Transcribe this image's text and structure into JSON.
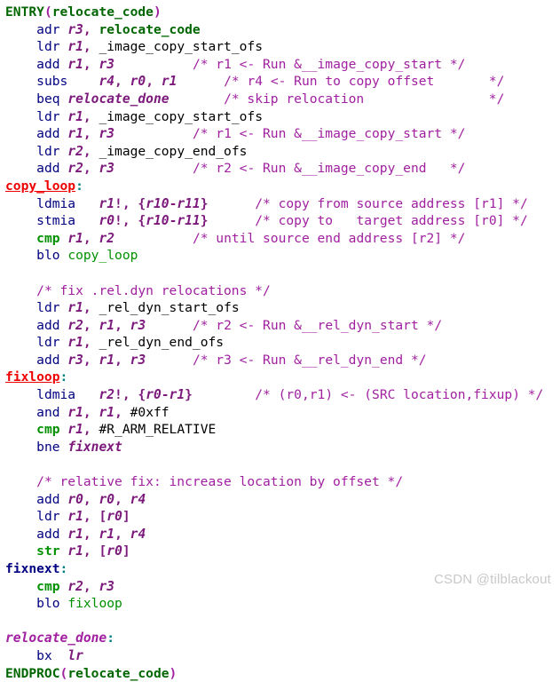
{
  "editor": {
    "language": "arm-assembly",
    "background": "#ffffff",
    "colors": {
      "macro_green": "#006600",
      "keyword_green": "#009000",
      "opcode_navy": "#000080",
      "register_purple": "#7c1a7c",
      "comment_magenta": "#a020a0",
      "label_red": "#ee0000",
      "label_navy": "#000080",
      "label_purple": "#a020a0",
      "colon_teal": "#008080",
      "watermark_gray": "#c8c8c8",
      "text_black": "#000000"
    }
  },
  "lines": [
    {
      "id": "l01",
      "text": "ENTRY(relocate_code)"
    },
    {
      "id": "l02",
      "text": "    adr r3, relocate_code"
    },
    {
      "id": "l03",
      "text": "    ldr r1, _image_copy_start_ofs"
    },
    {
      "id": "l04",
      "text": "    add r1, r3          /* r1 <- Run &__image_copy_start */"
    },
    {
      "id": "l05",
      "text": "    subs    r4, r0, r1      /* r4 <- Run to copy offset       */"
    },
    {
      "id": "l06",
      "text": "    beq relocate_done       /* skip relocation                */"
    },
    {
      "id": "l07",
      "text": "    ldr r1, _image_copy_start_ofs"
    },
    {
      "id": "l08",
      "text": "    add r1, r3          /* r1 <- Run &__image_copy_start */"
    },
    {
      "id": "l09",
      "text": "    ldr r2, _image_copy_end_ofs"
    },
    {
      "id": "l10",
      "text": "    add r2, r3          /* r2 <- Run &__image_copy_end   */"
    },
    {
      "id": "l11",
      "text": "copy_loop:"
    },
    {
      "id": "l12",
      "text": "    ldmia   r1!, {r10-r11}      /* copy from source address [r1] */"
    },
    {
      "id": "l13",
      "text": "    stmia   r0!, {r10-r11}      /* copy to   target address [r0] */"
    },
    {
      "id": "l14",
      "text": "    cmp r1, r2          /* until source end address [r2] */"
    },
    {
      "id": "l15",
      "text": "    blo copy_loop"
    },
    {
      "id": "l16",
      "text": ""
    },
    {
      "id": "l17",
      "text": "    /* fix .rel.dyn relocations */"
    },
    {
      "id": "l18",
      "text": "    ldr r1, _rel_dyn_start_ofs"
    },
    {
      "id": "l19",
      "text": "    add r2, r1, r3      /* r2 <- Run &__rel_dyn_start */"
    },
    {
      "id": "l20",
      "text": "    ldr r1, _rel_dyn_end_ofs"
    },
    {
      "id": "l21",
      "text": "    add r3, r1, r3      /* r3 <- Run &__rel_dyn_end */"
    },
    {
      "id": "l22",
      "text": "fixloop:"
    },
    {
      "id": "l23",
      "text": "    ldmia   r2!, {r0-r1}        /* (r0,r1) <- (SRC location,fixup) */"
    },
    {
      "id": "l24",
      "text": "    and r1, r1, #0xff"
    },
    {
      "id": "l25",
      "text": "    cmp r1, #R_ARM_RELATIVE"
    },
    {
      "id": "l26",
      "text": "    bne fixnext"
    },
    {
      "id": "l27",
      "text": ""
    },
    {
      "id": "l28",
      "text": "    /* relative fix: increase location by offset */"
    },
    {
      "id": "l29",
      "text": "    add r0, r0, r4"
    },
    {
      "id": "l30",
      "text": "    ldr r1, [r0]"
    },
    {
      "id": "l31",
      "text": "    add r1, r1, r4"
    },
    {
      "id": "l32",
      "text": "    str r1, [r0]"
    },
    {
      "id": "l33",
      "text": "fixnext:"
    },
    {
      "id": "l34",
      "text": "    cmp r2, r3"
    },
    {
      "id": "l35",
      "text": "    blo fixloop"
    },
    {
      "id": "l36",
      "text": ""
    },
    {
      "id": "l37",
      "text": "relocate_done:"
    },
    {
      "id": "l38",
      "text": "    bx  lr"
    },
    {
      "id": "l39",
      "text": "ENDPROC(relocate_code)"
    }
  ],
  "tokens": {
    "l01": [
      {
        "t": "ENTRY",
        "c": "t-macro"
      },
      {
        "t": "(",
        "c": "t-paren"
      },
      {
        "t": "relocate_code",
        "c": "t-sym"
      },
      {
        "t": ")",
        "c": "t-paren"
      }
    ],
    "l02": [
      {
        "t": "    ",
        "c": "t-ident"
      },
      {
        "t": "adr",
        "c": "t-op"
      },
      {
        "t": " ",
        "c": "t-ident"
      },
      {
        "t": "r3",
        "c": "t-reg"
      },
      {
        "t": ",",
        "c": "t-punct"
      },
      {
        "t": " ",
        "c": "t-ident"
      },
      {
        "t": "relocate_code",
        "c": "t-sym"
      }
    ],
    "l03": [
      {
        "t": "    ",
        "c": "t-ident"
      },
      {
        "t": "ldr",
        "c": "t-op"
      },
      {
        "t": " ",
        "c": "t-ident"
      },
      {
        "t": "r1",
        "c": "t-reg"
      },
      {
        "t": ",",
        "c": "t-punct"
      },
      {
        "t": " _image_copy_start_ofs",
        "c": "t-ident"
      }
    ],
    "l04": [
      {
        "t": "    ",
        "c": "t-ident"
      },
      {
        "t": "add",
        "c": "t-op"
      },
      {
        "t": " ",
        "c": "t-ident"
      },
      {
        "t": "r1",
        "c": "t-reg"
      },
      {
        "t": ",",
        "c": "t-punct"
      },
      {
        "t": " ",
        "c": "t-ident"
      },
      {
        "t": "r3",
        "c": "t-reg"
      },
      {
        "t": "          ",
        "c": "t-ident"
      },
      {
        "t": "/* r1 <- Run &__image_copy_start */",
        "c": "t-comment"
      }
    ],
    "l05": [
      {
        "t": "    ",
        "c": "t-ident"
      },
      {
        "t": "subs",
        "c": "t-op"
      },
      {
        "t": "    ",
        "c": "t-ident"
      },
      {
        "t": "r4",
        "c": "t-reg"
      },
      {
        "t": ",",
        "c": "t-punct"
      },
      {
        "t": " ",
        "c": "t-ident"
      },
      {
        "t": "r0",
        "c": "t-reg"
      },
      {
        "t": ",",
        "c": "t-punct"
      },
      {
        "t": " ",
        "c": "t-ident"
      },
      {
        "t": "r1",
        "c": "t-reg"
      },
      {
        "t": "      ",
        "c": "t-ident"
      },
      {
        "t": "/* r4 <- Run to copy offset       */",
        "c": "t-comment"
      }
    ],
    "l06": [
      {
        "t": "    ",
        "c": "t-ident"
      },
      {
        "t": "beq",
        "c": "t-op"
      },
      {
        "t": " ",
        "c": "t-ident"
      },
      {
        "t": "relocate_done",
        "c": "t-target-purple"
      },
      {
        "t": "       ",
        "c": "t-ident"
      },
      {
        "t": "/* skip relocation                */",
        "c": "t-comment"
      }
    ],
    "l07": [
      {
        "t": "    ",
        "c": "t-ident"
      },
      {
        "t": "ldr",
        "c": "t-op"
      },
      {
        "t": " ",
        "c": "t-ident"
      },
      {
        "t": "r1",
        "c": "t-reg"
      },
      {
        "t": ",",
        "c": "t-punct"
      },
      {
        "t": " _image_copy_start_ofs",
        "c": "t-ident"
      }
    ],
    "l08": [
      {
        "t": "    ",
        "c": "t-ident"
      },
      {
        "t": "add",
        "c": "t-op"
      },
      {
        "t": " ",
        "c": "t-ident"
      },
      {
        "t": "r1",
        "c": "t-reg"
      },
      {
        "t": ",",
        "c": "t-punct"
      },
      {
        "t": " ",
        "c": "t-ident"
      },
      {
        "t": "r3",
        "c": "t-reg"
      },
      {
        "t": "          ",
        "c": "t-ident"
      },
      {
        "t": "/* r1 <- Run &__image_copy_start */",
        "c": "t-comment"
      }
    ],
    "l09": [
      {
        "t": "    ",
        "c": "t-ident"
      },
      {
        "t": "ldr",
        "c": "t-op"
      },
      {
        "t": " ",
        "c": "t-ident"
      },
      {
        "t": "r2",
        "c": "t-reg"
      },
      {
        "t": ",",
        "c": "t-punct"
      },
      {
        "t": " _image_copy_end_ofs",
        "c": "t-ident"
      }
    ],
    "l10": [
      {
        "t": "    ",
        "c": "t-ident"
      },
      {
        "t": "add",
        "c": "t-op"
      },
      {
        "t": " ",
        "c": "t-ident"
      },
      {
        "t": "r2",
        "c": "t-reg"
      },
      {
        "t": ",",
        "c": "t-punct"
      },
      {
        "t": " ",
        "c": "t-ident"
      },
      {
        "t": "r3",
        "c": "t-reg"
      },
      {
        "t": "          ",
        "c": "t-ident"
      },
      {
        "t": "/* r2 <- Run &__image_copy_end   */",
        "c": "t-comment"
      }
    ],
    "l11": [
      {
        "t": "copy_loop",
        "c": "t-lbl-red"
      },
      {
        "t": ":",
        "c": "t-colon"
      }
    ],
    "l12": [
      {
        "t": "    ",
        "c": "t-ident"
      },
      {
        "t": "ldmia",
        "c": "t-op"
      },
      {
        "t": "   ",
        "c": "t-ident"
      },
      {
        "t": "r1",
        "c": "t-reg"
      },
      {
        "t": "!,",
        "c": "t-punct"
      },
      {
        "t": " ",
        "c": "t-ident"
      },
      {
        "t": "{",
        "c": "t-punct"
      },
      {
        "t": "r10",
        "c": "t-reg"
      },
      {
        "t": "-",
        "c": "t-punct"
      },
      {
        "t": "r11",
        "c": "t-reg"
      },
      {
        "t": "}",
        "c": "t-punct"
      },
      {
        "t": "      ",
        "c": "t-ident"
      },
      {
        "t": "/* copy from source address [r1] */",
        "c": "t-comment"
      }
    ],
    "l13": [
      {
        "t": "    ",
        "c": "t-ident"
      },
      {
        "t": "stmia",
        "c": "t-op"
      },
      {
        "t": "   ",
        "c": "t-ident"
      },
      {
        "t": "r0",
        "c": "t-reg"
      },
      {
        "t": "!,",
        "c": "t-punct"
      },
      {
        "t": " ",
        "c": "t-ident"
      },
      {
        "t": "{",
        "c": "t-punct"
      },
      {
        "t": "r10",
        "c": "t-reg"
      },
      {
        "t": "-",
        "c": "t-punct"
      },
      {
        "t": "r11",
        "c": "t-reg"
      },
      {
        "t": "}",
        "c": "t-punct"
      },
      {
        "t": "      ",
        "c": "t-ident"
      },
      {
        "t": "/* copy to   target address [r0] */",
        "c": "t-comment"
      }
    ],
    "l14": [
      {
        "t": "    ",
        "c": "t-ident"
      },
      {
        "t": "cmp",
        "c": "t-opg"
      },
      {
        "t": " ",
        "c": "t-ident"
      },
      {
        "t": "r1",
        "c": "t-reg"
      },
      {
        "t": ",",
        "c": "t-punct"
      },
      {
        "t": " ",
        "c": "t-ident"
      },
      {
        "t": "r2",
        "c": "t-reg"
      },
      {
        "t": "          ",
        "c": "t-ident"
      },
      {
        "t": "/* until source end address [r2] */",
        "c": "t-comment"
      }
    ],
    "l15": [
      {
        "t": "    ",
        "c": "t-ident"
      },
      {
        "t": "blo",
        "c": "t-op"
      },
      {
        "t": " ",
        "c": "t-ident"
      },
      {
        "t": "copy_loop",
        "c": "t-label-l"
      }
    ],
    "l16": [],
    "l17": [
      {
        "t": "    ",
        "c": "t-ident"
      },
      {
        "t": "/* fix .rel.dyn relocations */",
        "c": "t-comment"
      }
    ],
    "l18": [
      {
        "t": "    ",
        "c": "t-ident"
      },
      {
        "t": "ldr",
        "c": "t-op"
      },
      {
        "t": " ",
        "c": "t-ident"
      },
      {
        "t": "r1",
        "c": "t-reg"
      },
      {
        "t": ",",
        "c": "t-punct"
      },
      {
        "t": " _rel_dyn_start_ofs",
        "c": "t-ident"
      }
    ],
    "l19": [
      {
        "t": "    ",
        "c": "t-ident"
      },
      {
        "t": "add",
        "c": "t-op"
      },
      {
        "t": " ",
        "c": "t-ident"
      },
      {
        "t": "r2",
        "c": "t-reg"
      },
      {
        "t": ",",
        "c": "t-punct"
      },
      {
        "t": " ",
        "c": "t-ident"
      },
      {
        "t": "r1",
        "c": "t-reg"
      },
      {
        "t": ",",
        "c": "t-punct"
      },
      {
        "t": " ",
        "c": "t-ident"
      },
      {
        "t": "r3",
        "c": "t-reg"
      },
      {
        "t": "      ",
        "c": "t-ident"
      },
      {
        "t": "/* r2 <- Run &__rel_dyn_start */",
        "c": "t-comment"
      }
    ],
    "l20": [
      {
        "t": "    ",
        "c": "t-ident"
      },
      {
        "t": "ldr",
        "c": "t-op"
      },
      {
        "t": " ",
        "c": "t-ident"
      },
      {
        "t": "r1",
        "c": "t-reg"
      },
      {
        "t": ",",
        "c": "t-punct"
      },
      {
        "t": " _rel_dyn_end_ofs",
        "c": "t-ident"
      }
    ],
    "l21": [
      {
        "t": "    ",
        "c": "t-ident"
      },
      {
        "t": "add",
        "c": "t-op"
      },
      {
        "t": " ",
        "c": "t-ident"
      },
      {
        "t": "r3",
        "c": "t-reg"
      },
      {
        "t": ",",
        "c": "t-punct"
      },
      {
        "t": " ",
        "c": "t-ident"
      },
      {
        "t": "r1",
        "c": "t-reg"
      },
      {
        "t": ",",
        "c": "t-punct"
      },
      {
        "t": " ",
        "c": "t-ident"
      },
      {
        "t": "r3",
        "c": "t-reg"
      },
      {
        "t": "      ",
        "c": "t-ident"
      },
      {
        "t": "/* r3 <- Run &__rel_dyn_end */",
        "c": "t-comment"
      }
    ],
    "l22": [
      {
        "t": "fixloop",
        "c": "t-lbl-red"
      },
      {
        "t": ":",
        "c": "t-colon"
      }
    ],
    "l23": [
      {
        "t": "    ",
        "c": "t-ident"
      },
      {
        "t": "ldmia",
        "c": "t-op"
      },
      {
        "t": "   ",
        "c": "t-ident"
      },
      {
        "t": "r2",
        "c": "t-reg"
      },
      {
        "t": "!,",
        "c": "t-punct"
      },
      {
        "t": " ",
        "c": "t-ident"
      },
      {
        "t": "{",
        "c": "t-punct"
      },
      {
        "t": "r0",
        "c": "t-reg"
      },
      {
        "t": "-",
        "c": "t-punct"
      },
      {
        "t": "r1",
        "c": "t-reg"
      },
      {
        "t": "}",
        "c": "t-punct"
      },
      {
        "t": "        ",
        "c": "t-ident"
      },
      {
        "t": "/* (r0,r1) <- (SRC location,fixup) */",
        "c": "t-comment"
      }
    ],
    "l24": [
      {
        "t": "    ",
        "c": "t-ident"
      },
      {
        "t": "and",
        "c": "t-op"
      },
      {
        "t": " ",
        "c": "t-ident"
      },
      {
        "t": "r1",
        "c": "t-reg"
      },
      {
        "t": ",",
        "c": "t-punct"
      },
      {
        "t": " ",
        "c": "t-ident"
      },
      {
        "t": "r1",
        "c": "t-reg"
      },
      {
        "t": ",",
        "c": "t-punct"
      },
      {
        "t": " #0xff",
        "c": "t-ident"
      }
    ],
    "l25": [
      {
        "t": "    ",
        "c": "t-ident"
      },
      {
        "t": "cmp",
        "c": "t-opg"
      },
      {
        "t": " ",
        "c": "t-ident"
      },
      {
        "t": "r1",
        "c": "t-reg"
      },
      {
        "t": ",",
        "c": "t-punct"
      },
      {
        "t": " #R_ARM_RELATIVE",
        "c": "t-ident"
      }
    ],
    "l26": [
      {
        "t": "    ",
        "c": "t-ident"
      },
      {
        "t": "bne",
        "c": "t-op"
      },
      {
        "t": " ",
        "c": "t-ident"
      },
      {
        "t": "fixnext",
        "c": "t-target-purple"
      }
    ],
    "l27": [],
    "l28": [
      {
        "t": "    ",
        "c": "t-ident"
      },
      {
        "t": "/* relative fix: increase location by offset */",
        "c": "t-comment"
      }
    ],
    "l29": [
      {
        "t": "    ",
        "c": "t-ident"
      },
      {
        "t": "add",
        "c": "t-op"
      },
      {
        "t": " ",
        "c": "t-ident"
      },
      {
        "t": "r0",
        "c": "t-reg"
      },
      {
        "t": ",",
        "c": "t-punct"
      },
      {
        "t": " ",
        "c": "t-ident"
      },
      {
        "t": "r0",
        "c": "t-reg"
      },
      {
        "t": ",",
        "c": "t-punct"
      },
      {
        "t": " ",
        "c": "t-ident"
      },
      {
        "t": "r4",
        "c": "t-reg"
      }
    ],
    "l30": [
      {
        "t": "    ",
        "c": "t-ident"
      },
      {
        "t": "ldr",
        "c": "t-op"
      },
      {
        "t": " ",
        "c": "t-ident"
      },
      {
        "t": "r1",
        "c": "t-reg"
      },
      {
        "t": ",",
        "c": "t-punct"
      },
      {
        "t": " ",
        "c": "t-ident"
      },
      {
        "t": "[",
        "c": "t-punct"
      },
      {
        "t": "r0",
        "c": "t-reg"
      },
      {
        "t": "]",
        "c": "t-punct"
      }
    ],
    "l31": [
      {
        "t": "    ",
        "c": "t-ident"
      },
      {
        "t": "add",
        "c": "t-op"
      },
      {
        "t": " ",
        "c": "t-ident"
      },
      {
        "t": "r1",
        "c": "t-reg"
      },
      {
        "t": ",",
        "c": "t-punct"
      },
      {
        "t": " ",
        "c": "t-ident"
      },
      {
        "t": "r1",
        "c": "t-reg"
      },
      {
        "t": ",",
        "c": "t-punct"
      },
      {
        "t": " ",
        "c": "t-ident"
      },
      {
        "t": "r4",
        "c": "t-reg"
      }
    ],
    "l32": [
      {
        "t": "    ",
        "c": "t-ident"
      },
      {
        "t": "str",
        "c": "t-opg"
      },
      {
        "t": " ",
        "c": "t-ident"
      },
      {
        "t": "r1",
        "c": "t-reg"
      },
      {
        "t": ",",
        "c": "t-punct"
      },
      {
        "t": " ",
        "c": "t-ident"
      },
      {
        "t": "[",
        "c": "t-punct"
      },
      {
        "t": "r0",
        "c": "t-reg"
      },
      {
        "t": "]",
        "c": "t-punct"
      }
    ],
    "l33": [
      {
        "t": "fixnext",
        "c": "t-lbl-navy"
      },
      {
        "t": ":",
        "c": "t-colon"
      }
    ],
    "l34": [
      {
        "t": "    ",
        "c": "t-ident"
      },
      {
        "t": "cmp",
        "c": "t-opg"
      },
      {
        "t": " ",
        "c": "t-ident"
      },
      {
        "t": "r2",
        "c": "t-reg"
      },
      {
        "t": ",",
        "c": "t-punct"
      },
      {
        "t": " ",
        "c": "t-ident"
      },
      {
        "t": "r3",
        "c": "t-reg"
      }
    ],
    "l35": [
      {
        "t": "    ",
        "c": "t-ident"
      },
      {
        "t": "blo",
        "c": "t-op"
      },
      {
        "t": " ",
        "c": "t-ident"
      },
      {
        "t": "fixloop",
        "c": "t-label-l"
      }
    ],
    "l36": [],
    "l37": [
      {
        "t": "relocate_done",
        "c": "t-lbl-purple"
      },
      {
        "t": ":",
        "c": "t-colon"
      }
    ],
    "l38": [
      {
        "t": "    ",
        "c": "t-ident"
      },
      {
        "t": "bx",
        "c": "t-op"
      },
      {
        "t": "  ",
        "c": "t-ident"
      },
      {
        "t": "lr",
        "c": "t-reg"
      }
    ],
    "l39": [
      {
        "t": "ENDPROC",
        "c": "t-macro"
      },
      {
        "t": "(",
        "c": "t-paren"
      },
      {
        "t": "relocate_code",
        "c": "t-sym"
      },
      {
        "t": ")",
        "c": "t-paren"
      }
    ]
  },
  "watermark": {
    "text": "CSDN @tilblackout"
  }
}
